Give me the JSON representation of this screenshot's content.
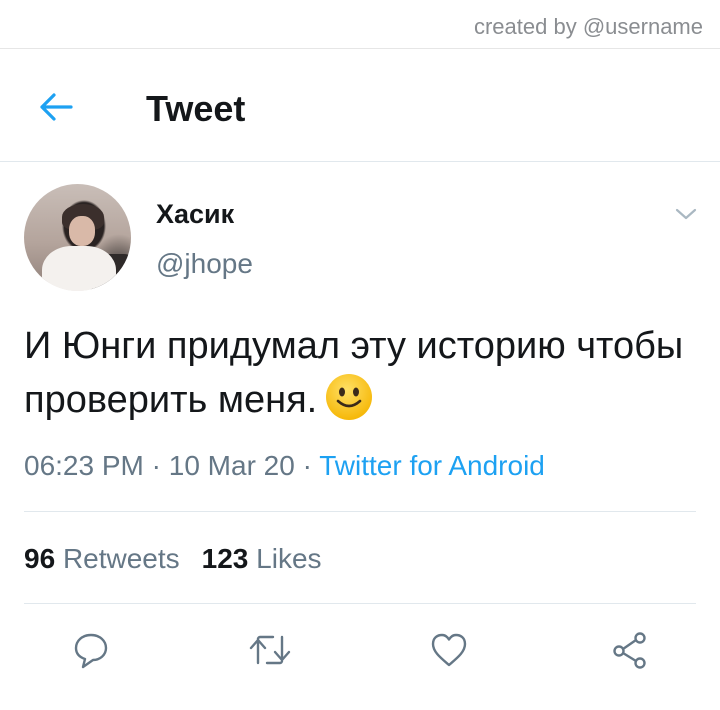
{
  "credit": "created by @username",
  "header": {
    "title": "Tweet"
  },
  "tweet": {
    "author_name": "Хасик",
    "author_handle": "@jhope",
    "text": "И Юнги придумал эту историю чтобы проверить меня.",
    "emoji": "slightly-smiling-face",
    "time": "06:23 PM",
    "date": "10 Mar 20",
    "separator": "·",
    "source": "Twitter for Android"
  },
  "stats": {
    "retweets_count": "96",
    "retweets_label": "Retweets",
    "likes_count": "123",
    "likes_label": "Likes"
  },
  "actions": [
    "reply-icon",
    "retweet-icon",
    "like-icon",
    "share-icon"
  ],
  "colors": {
    "accent": "#1da1f2",
    "secondary_text": "#657786",
    "primary_text": "#14171a"
  }
}
